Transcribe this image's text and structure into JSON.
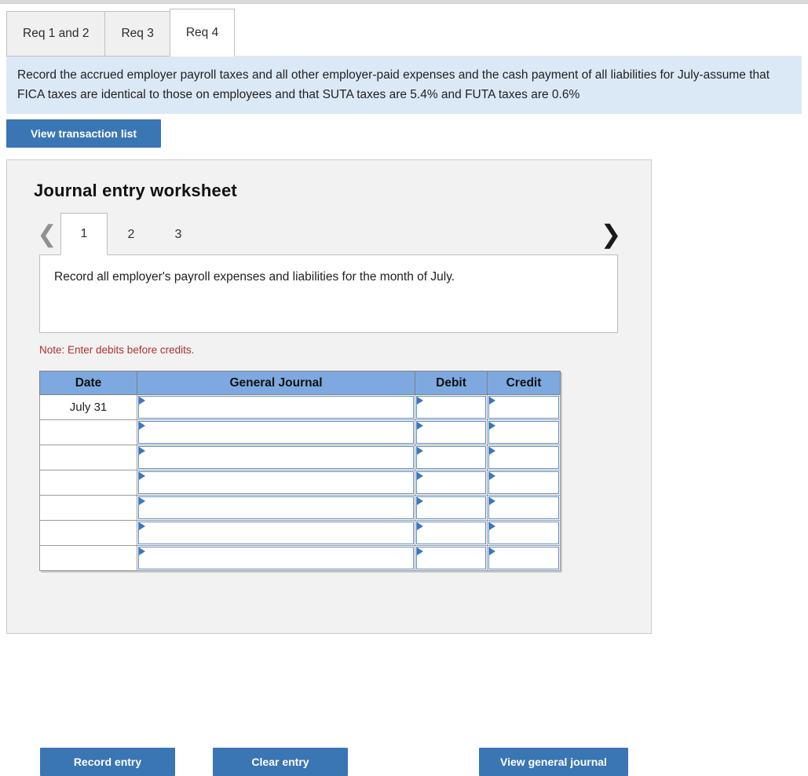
{
  "tabs": [
    {
      "label": "Req 1 and 2",
      "active": false
    },
    {
      "label": "Req 3",
      "active": false
    },
    {
      "label": "Req 4",
      "active": true
    }
  ],
  "banner": {
    "text": "Record the accrued employer payroll taxes and all other employer-paid expenses and the cash payment of all liabilities for July-assume that FICA taxes are identical to those on employees and that SUTA taxes are 5.4% and FUTA taxes are 0.6%"
  },
  "toolbar": {
    "view_transaction_list_label": "View transaction list"
  },
  "worksheet": {
    "title": "Journal entry worksheet",
    "prev_icon": "chevron-left-icon",
    "next_icon": "chevron-right-icon",
    "pages": [
      {
        "label": "1",
        "active": true
      },
      {
        "label": "2",
        "active": false
      },
      {
        "label": "3",
        "active": false
      }
    ],
    "description": "Record all employer's payroll expenses and liabilities for the month of July.",
    "note": "Note: Enter debits before credits."
  },
  "journal_table": {
    "columns": [
      "Date",
      "General Journal",
      "Debit",
      "Credit"
    ],
    "rows": [
      {
        "date": "July 31",
        "general_journal": "",
        "debit": "",
        "credit": ""
      },
      {
        "date": "",
        "general_journal": "",
        "debit": "",
        "credit": ""
      },
      {
        "date": "",
        "general_journal": "",
        "debit": "",
        "credit": ""
      },
      {
        "date": "",
        "general_journal": "",
        "debit": "",
        "credit": ""
      },
      {
        "date": "",
        "general_journal": "",
        "debit": "",
        "credit": ""
      },
      {
        "date": "",
        "general_journal": "",
        "debit": "",
        "credit": ""
      },
      {
        "date": "",
        "general_journal": "",
        "debit": "",
        "credit": ""
      }
    ]
  },
  "actions": {
    "record_entry_label": "Record entry",
    "clear_entry_label": "Clear entry",
    "view_general_journal_label": "View general journal"
  },
  "colors": {
    "primary_button": "#3a75b4",
    "table_header": "#7da9e0",
    "banner_background": "#dbe9f7",
    "panel_background": "#f2f2f2",
    "note_text": "#b03030",
    "cell_border": "#5b8fcc"
  }
}
